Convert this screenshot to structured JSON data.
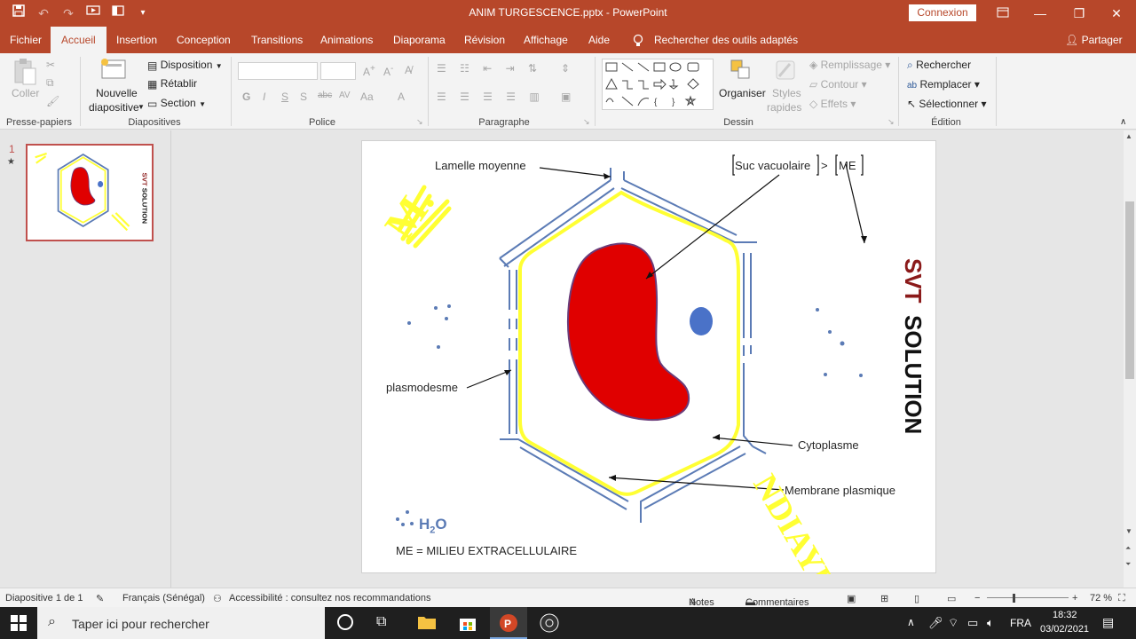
{
  "window": {
    "title": "ANIM TURGESCENCE.pptx  -  PowerPoint",
    "connexion_label": "Connexion"
  },
  "tabs": [
    "Fichier",
    "Accueil",
    "Insertion",
    "Conception",
    "Transitions",
    "Animations",
    "Diaporama",
    "Révision",
    "Affichage",
    "Aide"
  ],
  "tell_me": "Rechercher des outils adaptés",
  "share_label": "Partager",
  "ribbon": {
    "clipboard": {
      "paste_label": "Coller",
      "group": "Presse-papiers"
    },
    "slides": {
      "new_slide_line1": "Nouvelle",
      "new_slide_line2": "diapositive",
      "layout": "Disposition",
      "reset": "Rétablir",
      "section": "Section",
      "group": "Diapositives"
    },
    "font": {
      "group": "Police",
      "bold": "G",
      "italic": "I",
      "underline": "S",
      "shadow": "S",
      "strike": "abc",
      "spacing": "AV",
      "case": "Aa",
      "color": "A"
    },
    "paragraph": {
      "group": "Paragraphe"
    },
    "drawing": {
      "arrange": "Organiser",
      "styles_line1": "Styles",
      "styles_line2": "rapides",
      "fill": "Remplissage",
      "outline": "Contour",
      "effects": "Effets",
      "group": "Dessin"
    },
    "editing": {
      "find": "Rechercher",
      "replace": "Remplacer",
      "select": "Sélectionner",
      "group": "Édition"
    }
  },
  "thumbnails": [
    {
      "number": "1",
      "star": "★"
    }
  ],
  "slide": {
    "label_lamelle": "Lamelle moyenne",
    "label_suc": "Suc vacuolaire",
    "label_gt": ">",
    "label_me": "ME",
    "label_plasmodesme": "plasmodesme",
    "label_cytoplasme": "Cytoplasme",
    "label_membrane": "Membrane plasmique",
    "h2o_h": "H",
    "h2o_sub": "2",
    "h2o_o": "O",
    "legend": "ME = MILIEU EXTRACELLULAIRE",
    "watermark_svt": "SVT",
    "watermark_solution": "SOLUTION",
    "scribble_top": "M.",
    "scribble_bottom": "NDIAYE"
  },
  "status": {
    "slide_of": "Diapositive 1 de 1",
    "language": "Français (Sénégal)",
    "accessibility": "Accessibilité : consultez nos recommandations",
    "notes": "Notes",
    "comments": "Commentaires",
    "zoom": "72 %"
  },
  "taskbar": {
    "search_placeholder": "Taper ici pour rechercher",
    "lang": "FRA",
    "time": "18:32",
    "date": "03/02/2021"
  },
  "colors": {
    "accent": "#b7472a",
    "vacuole": "#e00000",
    "wall": "#5b7bb5",
    "membrane": "#ffff33",
    "nucleus": "#4a72c8"
  }
}
